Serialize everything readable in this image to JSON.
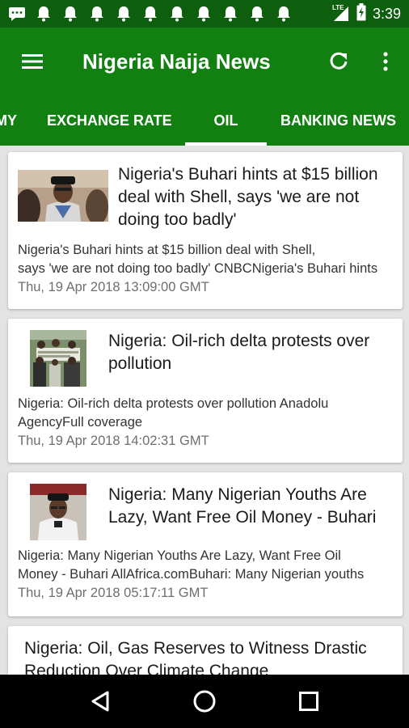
{
  "status_bar": {
    "time": "3:39",
    "network": "LTE",
    "notification_icons": [
      "message-icon",
      "bell-icon",
      "bell-icon",
      "bell-icon",
      "bell-icon",
      "bell-icon",
      "bell-icon",
      "bell-icon",
      "bell-icon",
      "bell-icon",
      "bell-icon"
    ]
  },
  "app_bar": {
    "title": "Nigeria Naija News"
  },
  "tabs": [
    {
      "label": "MY",
      "active": false
    },
    {
      "label": "EXCHANGE RATE",
      "active": false
    },
    {
      "label": "OIL",
      "active": true
    },
    {
      "label": "BANKING NEWS",
      "active": false
    }
  ],
  "articles": [
    {
      "title": "Nigeria's Buhari hints at $15 billion deal with Shell, says 'we are not doing too badly'",
      "desc_line1": "Nigeria's Buhari hints at $15 billion deal with Shell,",
      "desc_line2": "says 'we are not doing too badly'  CNBCNigeria's Buhari hints",
      "date": "Thu, 19 Apr 2018 13:09:00 GMT",
      "thumbnail": "buhari-portrait"
    },
    {
      "title": "Nigeria: Oil-rich delta protests over pollution",
      "desc_line1": "Nigeria: Oil-rich delta protests over pollution  Anadolu",
      "desc_line2": "AgencyFull coverage",
      "date": "Thu, 19 Apr 2018 14:02:31 GMT",
      "thumbnail": "protest-crowd"
    },
    {
      "title": "Nigeria: Many Nigerian Youths Are Lazy, Want Free Oil Money - Buhari",
      "desc_line1": "Nigeria: Many Nigerian Youths Are Lazy, Want Free Oil",
      "desc_line2": "Money - Buhari  AllAfrica.comBuhari: Many Nigerian youths",
      "date": "Thu, 19 Apr 2018 05:17:11 GMT",
      "thumbnail": "buhari-speaking"
    },
    {
      "title": "Nigeria: Oil, Gas Reserves to Witness Drastic Reduction Over Climate Change",
      "desc_line1": "",
      "desc_line2": "",
      "date": "",
      "thumbnail": ""
    }
  ],
  "colors": {
    "status_bar": "#0d5e0d",
    "app_bar": "#118011",
    "card_bg": "#ffffff",
    "list_bg": "#e3e3e3"
  }
}
